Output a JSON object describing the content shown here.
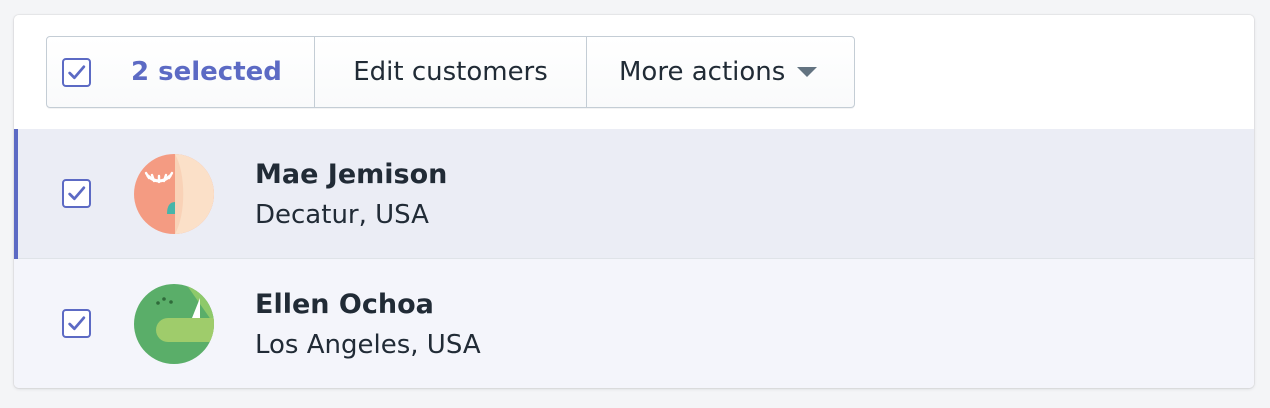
{
  "bulk_actions": {
    "selected_label": "2 selected",
    "edit_label": "Edit customers",
    "more_label": "More actions"
  },
  "customers": [
    {
      "name": "Mae Jemison",
      "location": "Decatur, USA",
      "selected": true
    },
    {
      "name": "Ellen Ochoa",
      "location": "Los Angeles, USA",
      "selected": true
    }
  ],
  "colors": {
    "accent": "#5c6ac4",
    "selected_row": "#ebedf5",
    "text": "#212b36"
  }
}
